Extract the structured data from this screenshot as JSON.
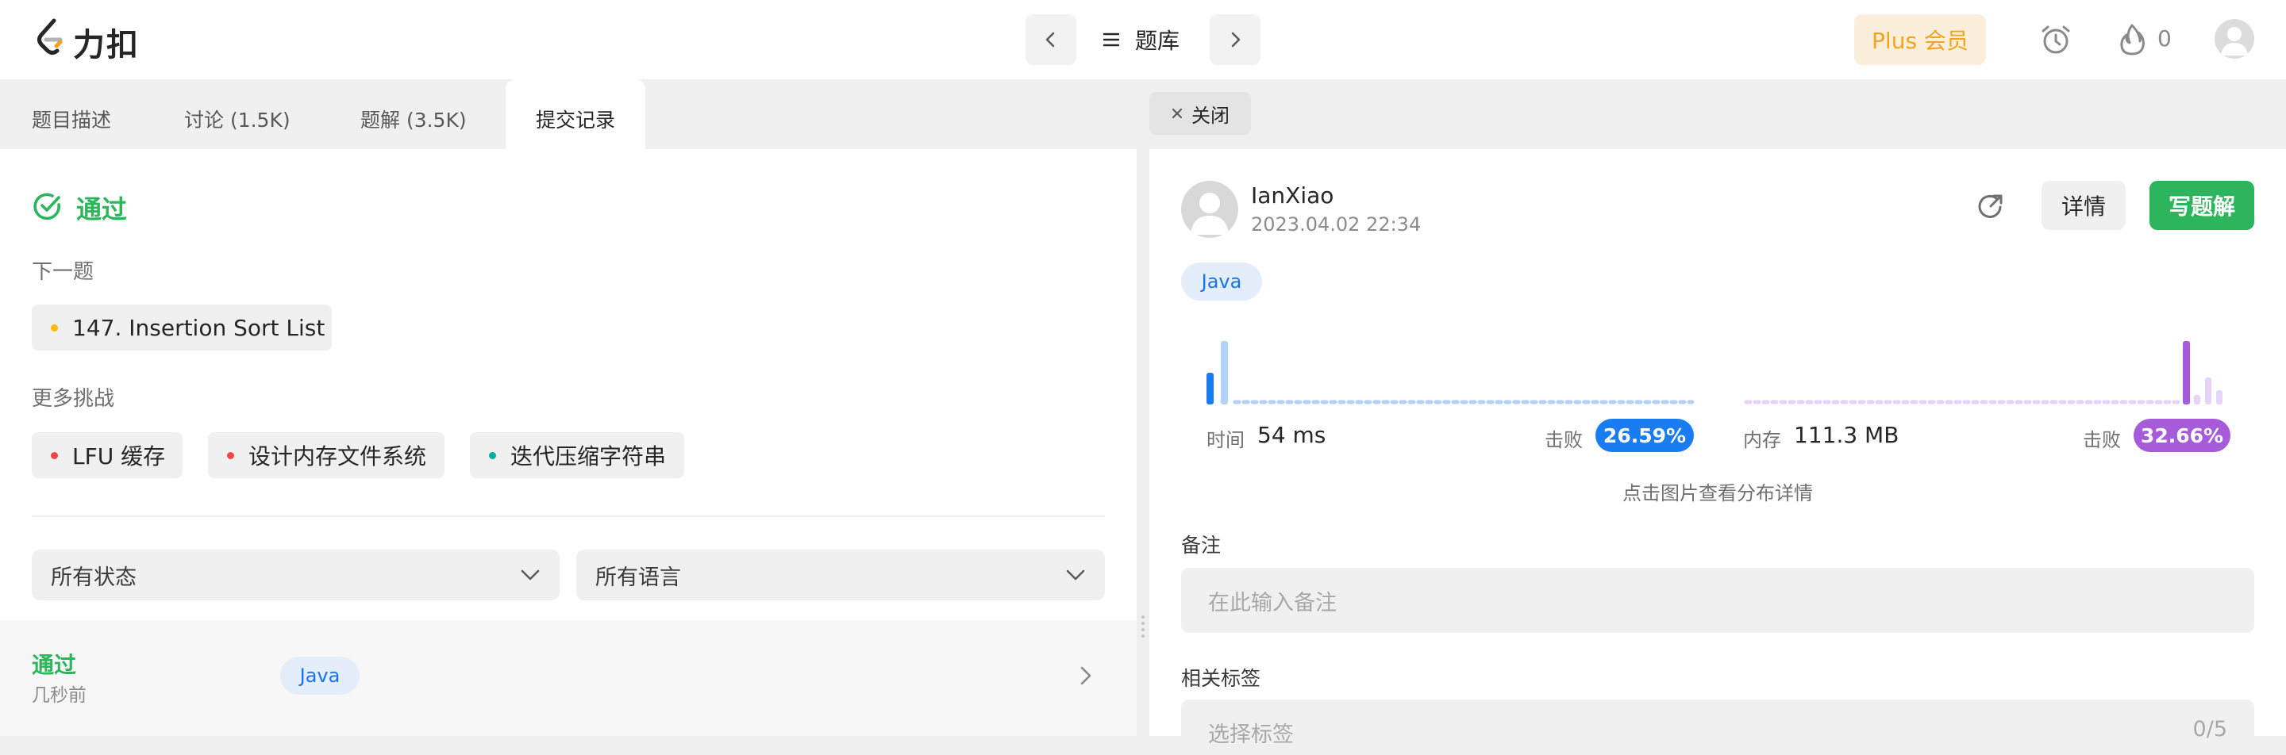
{
  "header": {
    "logo_text": "力扣",
    "problem_bank": "题库",
    "plus_label": "Plus 会员",
    "streak_count": "0"
  },
  "left": {
    "tabs": [
      {
        "label": "题目描述"
      },
      {
        "label": "讨论 (1.5K)"
      },
      {
        "label": "题解 (3.5K)"
      },
      {
        "label": "提交记录"
      }
    ],
    "result": "通过",
    "next_label": "下一题",
    "next_problem": "147. Insertion Sort List",
    "more_label": "更多挑战",
    "challenges": [
      {
        "label": "LFU 缓存",
        "dot": "#ef4743"
      },
      {
        "label": "设计内存文件系统",
        "dot": "#ef4743"
      },
      {
        "label": "迭代压缩字符串",
        "dot": "#00af9b"
      }
    ],
    "filters": {
      "status": "所有状态",
      "language": "所有语言"
    },
    "submission": {
      "status": "通过",
      "time": "几秒前",
      "lang": "Java"
    }
  },
  "right": {
    "close_label": "关闭",
    "user": "IanXiao",
    "datetime": "2023.04.02 22:34",
    "lang": "Java",
    "detail_label": "详情",
    "write_label": "写题解",
    "runtime": {
      "label": "时间",
      "value": "54 ms",
      "beats_label": "击败",
      "beats": "26.59%",
      "color": "#1a7cf2"
    },
    "memory": {
      "label": "内存",
      "value": "111.3 MB",
      "beats_label": "击败",
      "beats": "32.66%",
      "color": "#a65bd9"
    },
    "hint": "点击图片查看分布详情",
    "note_label": "备注",
    "note_placeholder": "在此输入备注",
    "tags_label": "相关标签",
    "tags_placeholder": "选择标签",
    "tags_count": "0/5"
  },
  "colors": {
    "green": "#2db55d",
    "blue": "#1a7cf2",
    "purple": "#a65bd9",
    "orange": "#f2a41f"
  }
}
